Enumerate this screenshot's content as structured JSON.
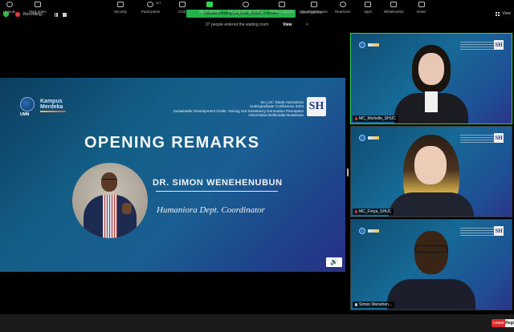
{
  "topbar": {
    "recording_label": "Recording...",
    "viewing_banner": "You are viewing Co_Host_SHUC's screen",
    "view_options": "View Options",
    "view_label": "View"
  },
  "waiting_room": {
    "message": "37 people entered the waiting room",
    "view_button": "View",
    "close_glyph": "×"
  },
  "slide": {
    "umn_text": "UMN",
    "kampus_line1": "Kampus",
    "kampus_line2": "Merdeka",
    "conf_lines": [
      "SH_UC: Study Humaniora",
      "Undergraduate Conference 2024",
      "Sustainable Development Goals: Voicing Out Strawberry Generation Perception",
      "Universitas Multimedia Nusantara"
    ],
    "sh_logo": "SH",
    "title": "OPENING REMARKS",
    "speaker_name": "DR. SIMON WENEHENUBUN",
    "speaker_role": "Humaniora Dept. Coordinator"
  },
  "participants": [
    {
      "name": "MC_Michelle_SHUC",
      "muted": true
    },
    {
      "name": "MC_Freya_SHUC",
      "muted": true
    },
    {
      "name": "Simon Wenehen...",
      "muted": false
    }
  ],
  "toolbar": {
    "items": [
      "Unmute",
      "Start Video",
      "Security",
      "Participants",
      "Chat",
      "Share Screen",
      "Pause/Stop Recording",
      "Show Captions",
      "Breakout Rooms",
      "Reactions",
      "Apps",
      "Whiteboards",
      "Notes"
    ],
    "participants_count": "347",
    "leave": "Leave",
    "corner": "Regi"
  },
  "colors": {
    "accent_green": "#24b34b",
    "leave_red": "#d92b2b",
    "slide_blue": "#135f87"
  }
}
